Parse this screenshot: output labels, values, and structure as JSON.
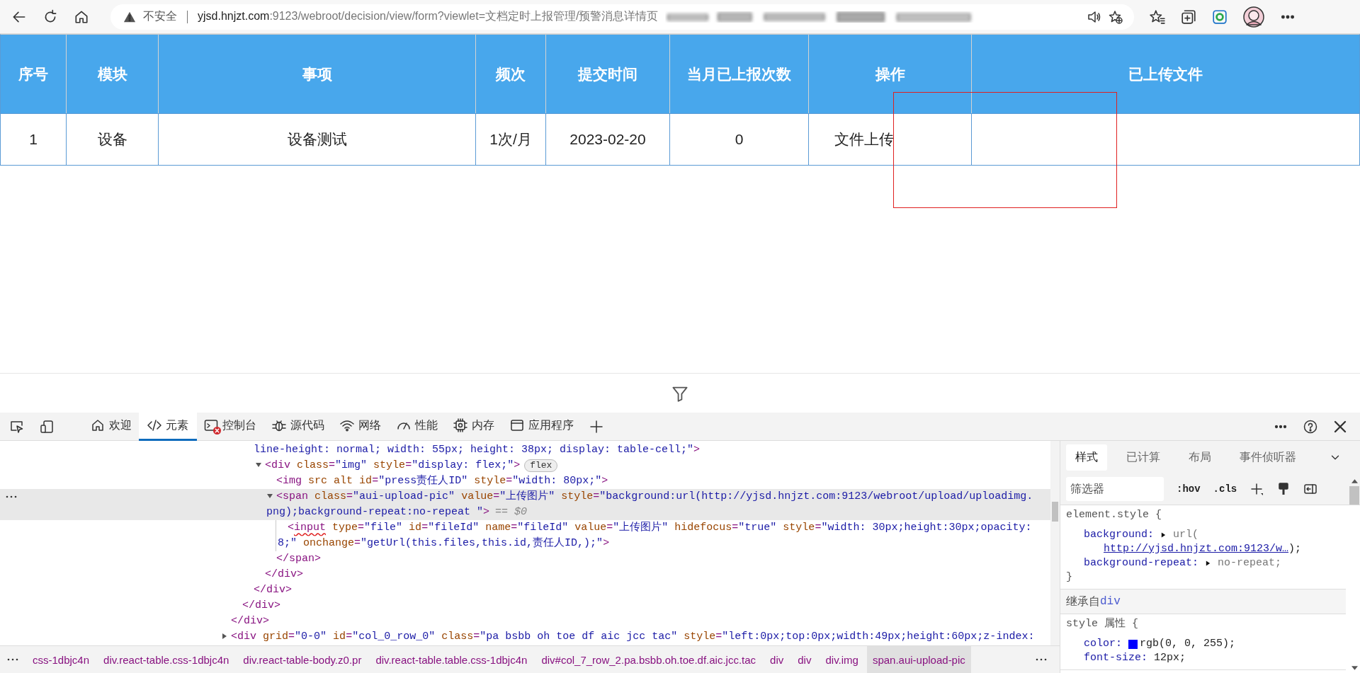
{
  "browser": {
    "security_label": "不安全",
    "url_host": "yjsd.hnjzt.com",
    "url_rest": ":9123/webroot/decision/view/form?viewlet=文档定时上报管理/预警消息详情页"
  },
  "table": {
    "columns": [
      "序号",
      "模块",
      "事项",
      "频次",
      "提交时间",
      "当月已上报次数",
      "操作",
      "已上传文件"
    ],
    "rows": [
      {
        "cells": [
          "1",
          "设备",
          "设备测试",
          "1次/月",
          "2023-02-20",
          "0",
          "文件上传"
        ]
      }
    ]
  },
  "devtools": {
    "tabs": [
      {
        "label": "欢迎",
        "selected": false,
        "has_errors": false
      },
      {
        "label": "元素",
        "selected": true,
        "has_errors": false
      },
      {
        "label": "控制台",
        "selected": false,
        "has_errors": true
      },
      {
        "label": "源代码",
        "selected": false,
        "has_errors": false
      },
      {
        "label": "网络",
        "selected": false,
        "has_errors": false
      },
      {
        "label": "性能",
        "selected": false,
        "has_errors": false
      },
      {
        "label": "内存",
        "selected": false,
        "has_errors": false
      },
      {
        "label": "应用程序",
        "selected": false,
        "has_errors": false
      }
    ],
    "dom": [
      {
        "close": "</div>",
        "children": [
          {
            "close": "</div>",
            "children": [
              {
                "open": [
                  "line-height: normal; width: 55px; height: 38px; display: table-cell;\">"
                ],
                "continued": true,
                "selected": false,
                "close": "</div>",
                "children": [
                  {
                    "open": [
                      "<div class=\"img\" style=\"display: flex;\">"
                    ],
                    "expanded": true,
                    "selected": false,
                    "badge": "flex",
                    "close": "</div>",
                    "children": [
                      {
                        "open": [
                          "<img src alt id=\"press责任人ID\" style=\"width: 80px;\">"
                        ],
                        "selected": false
                      },
                      {
                        "open": [
                          "<span class=\"aui-upload-pic\" value=\"上传图片\" style=\"background:url(http://yjsd.hnjzt.com:9123/webroot/upload/uploadimg.",
                          "png);background-repeat:no-repeat \">"
                        ],
                        "expanded": true,
                        "selected": true,
                        "marker": "== $0",
                        "close": "</span>",
                        "children": [
                          {
                            "open": [
                              "<input type=\"file\" id=\"fileId\" name=\"fileId\" value=\"上传图片\" hidefocus=\"true\" style=\"width: 30px;height:30px;opacity:",
                              "8;\" onchange=\"getUrl(this.files,this.id,责任人ID,);\">"
                            ],
                            "selected": false,
                            "spelling_error": true
                          }
                        ]
                      }
                    ]
                  }
                ]
              }
            ]
          }
        ]
      },
      {
        "open": [
          "<div grid=\"0-0\" id=\"col_0_row_0\" class=\"pa bsbb oh toe df aic jcc tac\" style=\"left:0px;top:0px;width:49px;height:60px;z-index:"
        ],
        "expanded": false,
        "selected": false
      }
    ],
    "breadcrumbs": [
      {
        "label": "css-1dbjc4n",
        "selected": false
      },
      {
        "label": "div.react-table.css-1dbjc4n",
        "selected": false
      },
      {
        "label": "div.react-table-body.z0.pr",
        "selected": false
      },
      {
        "label": "div.react-table.table.css-1dbjc4n",
        "selected": false
      },
      {
        "label": "div#col_7_row_2.pa.bsbb.oh.toe.df.aic.jcc.tac",
        "selected": false
      },
      {
        "label": "div",
        "selected": false
      },
      {
        "label": "div",
        "selected": false
      },
      {
        "label": "div.img",
        "selected": false
      },
      {
        "label": "span.aui-upload-pic",
        "selected": true
      }
    ],
    "styles": {
      "tabs": [
        {
          "label": "样式",
          "selected": true
        },
        {
          "label": "已计算",
          "selected": false
        },
        {
          "label": "布局",
          "selected": false
        },
        {
          "label": "事件侦听器",
          "selected": false
        }
      ],
      "filter": {
        "placeholder": "筛选器"
      },
      "toggles": [
        ":hov",
        ".cls"
      ],
      "rules": [
        {
          "kind": "rule",
          "selector": "element.style {",
          "declarations": [
            {
              "property": "background:",
              "expandable": true,
              "value": "url(",
              "link": "http://yjsd.hnjzt.com:9123/w…",
              "value_end": ");"
            },
            {
              "property": "background-repeat:",
              "expandable": true,
              "value": "no-repeat;"
            }
          ],
          "close": "}"
        },
        {
          "kind": "inherited",
          "label": "继承自",
          "source": "div"
        },
        {
          "kind": "rule",
          "selector": "style 属性 {",
          "declarations": [
            {
              "property": "color:",
              "swatch": true,
              "value": "rgb(0, 0, 255);"
            },
            {
              "property": "font-size:",
              "value": "12px;"
            }
          ]
        }
      ]
    }
  }
}
